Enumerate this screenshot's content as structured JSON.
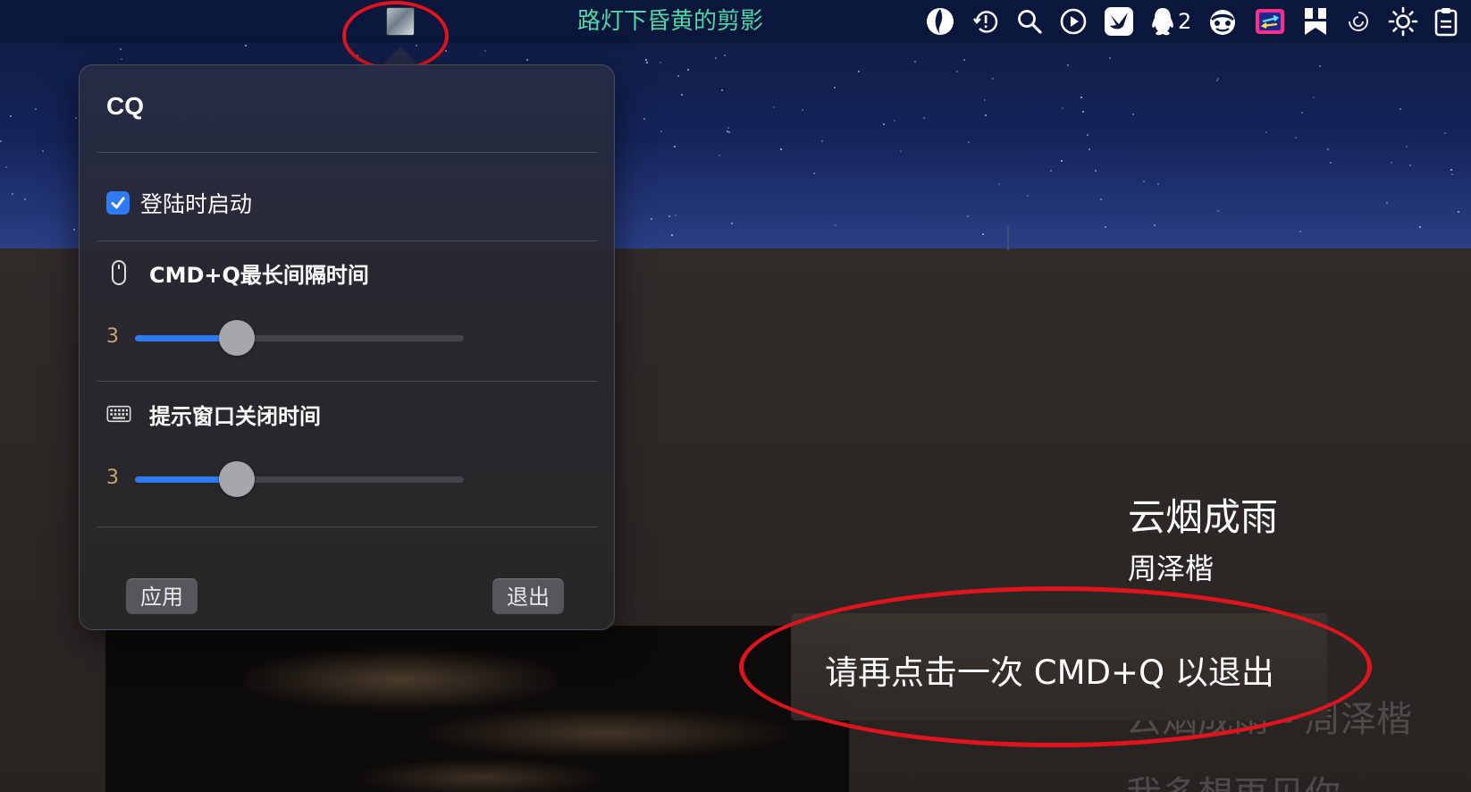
{
  "menubar": {
    "app_icon": "cq-app-icon",
    "now_playing": "路灯下昏黄的剪影",
    "now_playing_color": "#52d6a5",
    "tray_icons": [
      "lulu-icon",
      "clock-alert-icon",
      "search-icon",
      "play-circle-icon",
      "bird-app-icon",
      "qq-icon",
      "mask-icon",
      "screen-mirror-icon",
      "bookmark-app-icon",
      "swirl-icon",
      "brightness-icon",
      "clipboard-icon"
    ],
    "qq_badge": "2"
  },
  "popover": {
    "title": "CQ",
    "launch_at_login": {
      "label": "登陆时启动",
      "checked": true
    },
    "max_interval": {
      "label": "CMD+Q最长间隔时间",
      "icon": "mouse-icon",
      "value": "3",
      "fraction": 0.31
    },
    "hint_close": {
      "label": "提示窗口关闭时间",
      "icon": "keyboard-icon",
      "value": "3",
      "fraction": 0.31
    },
    "apply_label": "应用",
    "quit_label": "退出"
  },
  "player": {
    "song_title": "云烟成雨",
    "artist": "周泽楷",
    "lyric_current": "云烟成雨 - 周泽楷",
    "lyric_next": "我多想再见你"
  },
  "toast": {
    "message": "请再点击一次 CMD+Q 以退出"
  },
  "colors": {
    "accent": "#2f7bf5",
    "slider_value": "#c9a574",
    "annotation_red": "#e0141c"
  }
}
